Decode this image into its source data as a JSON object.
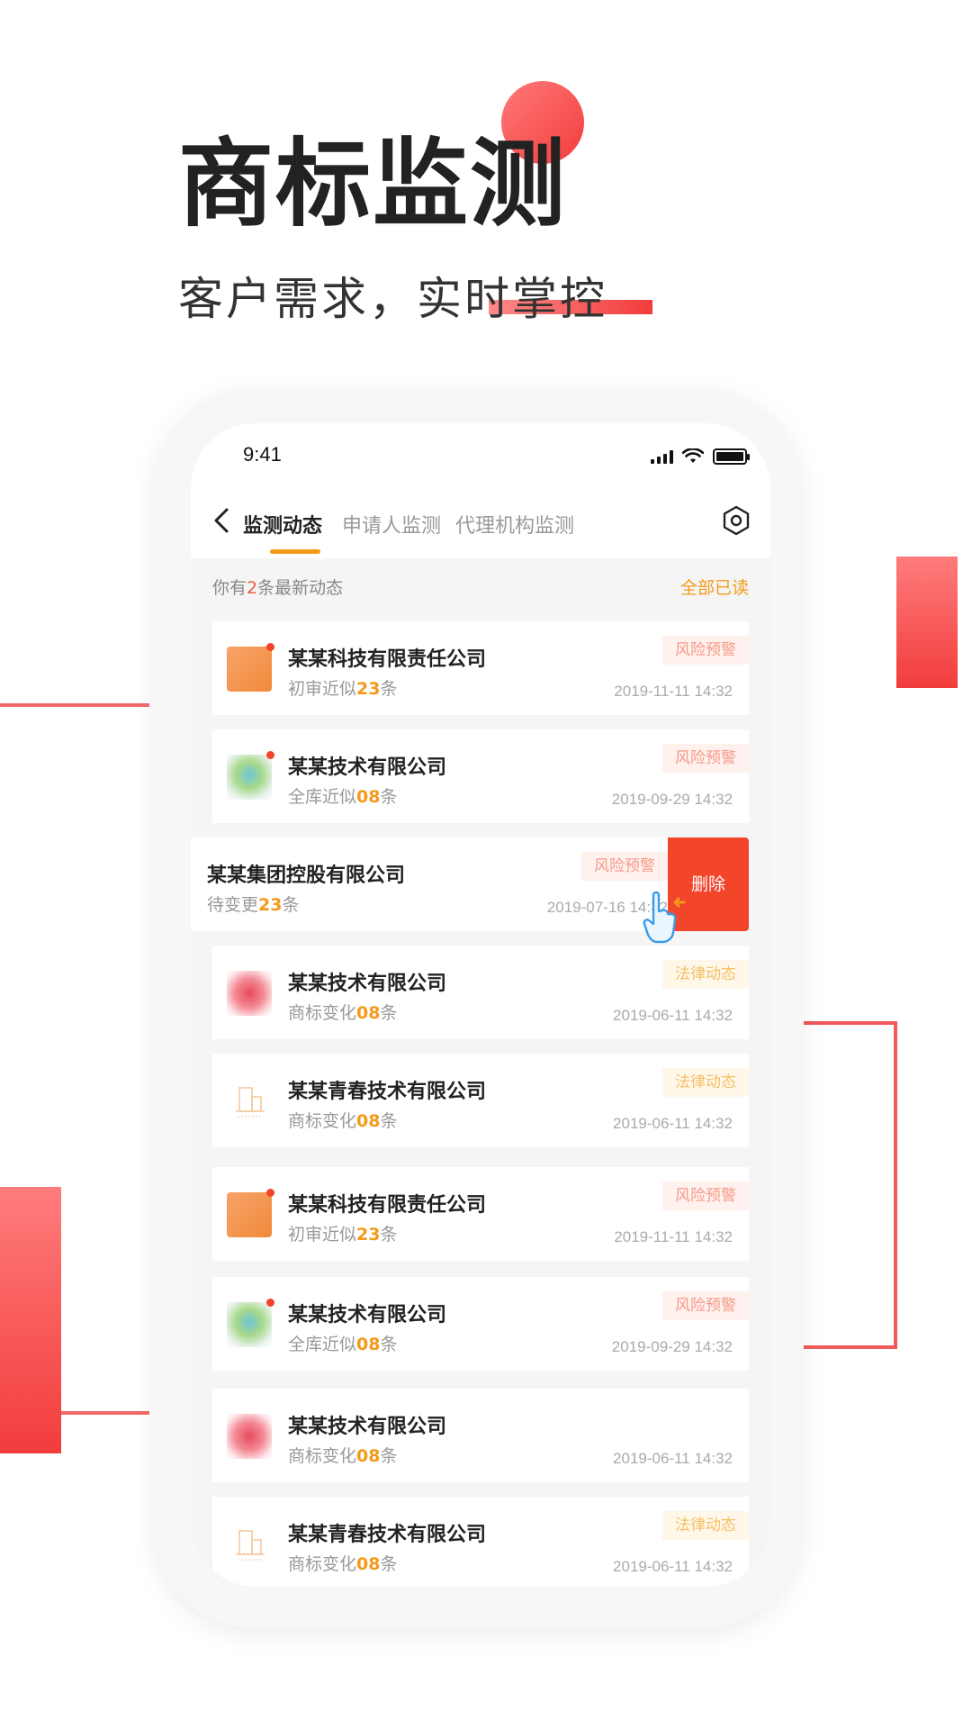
{
  "promo": {
    "title": "商标监测",
    "subtitle": "客户需求，实时掌控"
  },
  "status_bar": {
    "time": "9:41",
    "icons": [
      "signal-icon",
      "wifi-icon",
      "battery-icon"
    ]
  },
  "nav": {
    "back_icon": "chevron-left-icon",
    "tabs": [
      {
        "label": "监测动态",
        "active": true
      },
      {
        "label": "申请人监测",
        "active": false
      },
      {
        "label": "代理机构监测",
        "active": false
      }
    ],
    "settings_icon": "hexagon-settings-icon"
  },
  "notice": {
    "prefix": "你有",
    "count": "2",
    "suffix": "条最新动态",
    "read_all": "全部已读"
  },
  "list": [
    {
      "name": "某某科技有限责任公司",
      "sub_prefix": "初审近似",
      "count": "23",
      "sub_suffix": "条",
      "tag": "风险预警",
      "time": "2019-11-11 14:32"
    },
    {
      "name": "某某技术有限公司",
      "sub_prefix": "全库近似",
      "count": "08",
      "sub_suffix": "条",
      "tag": "风险预警",
      "time": "2019-09-29 14:32"
    },
    {
      "name": "某某集团控股有限公司",
      "sub_prefix": "待变更",
      "count": "23",
      "sub_suffix": "条",
      "tag": "风险预警",
      "time": "2019-07-16 14:32",
      "action": "删除"
    },
    {
      "name": "某某技术有限公司",
      "sub_prefix": "商标变化",
      "count": "08",
      "sub_suffix": "条",
      "tag": "法律动态",
      "time": "2019-06-11 14:32"
    },
    {
      "name": "某某青春技术有限公司",
      "sub_prefix": "商标变化",
      "count": "08",
      "sub_suffix": "条",
      "tag": "法律动态",
      "time": "2019-06-11 14:32"
    },
    {
      "name": "某某科技有限责任公司",
      "sub_prefix": "初审近似",
      "count": "23",
      "sub_suffix": "条",
      "tag": "风险预警",
      "time": "2019-11-11 14:32"
    },
    {
      "name": "某某技术有限公司",
      "sub_prefix": "全库近似",
      "count": "08",
      "sub_suffix": "条",
      "tag": "风险预警",
      "time": "2019-09-29 14:32"
    },
    {
      "name": "某某技术有限公司",
      "sub_prefix": "商标变化",
      "count": "08",
      "sub_suffix": "条",
      "tag": "",
      "time": "2019-06-11 14:32"
    },
    {
      "name": "某某青春技术有限公司",
      "sub_prefix": "商标变化",
      "count": "08",
      "sub_suffix": "条",
      "tag": "法律动态",
      "time": "2019-06-11 14:32"
    }
  ],
  "colors": {
    "accent_red": "#f23c3c",
    "accent_orange": "#f39a1a",
    "risk_tag_text": "#f59a88",
    "law_tag_text": "#f5c06a"
  }
}
